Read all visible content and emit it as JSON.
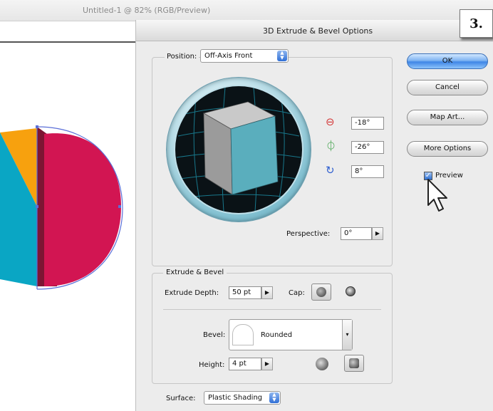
{
  "document": {
    "title": "Untitled-1 @ 82% (RGB/Preview)"
  },
  "step_badge": "3.",
  "dialog": {
    "title": "3D Extrude & Bevel Options",
    "position": {
      "label": "Position:",
      "value": "Off-Axis Front",
      "x_rotation": "-18°",
      "y_rotation": "-26°",
      "z_rotation": "8°",
      "perspective_label": "Perspective:",
      "perspective_value": "0°"
    },
    "extrude_bevel": {
      "legend": "Extrude & Bevel",
      "depth_label": "Extrude Depth:",
      "depth_value": "50 pt",
      "cap_label": "Cap:",
      "bevel_label": "Bevel:",
      "bevel_value": "Rounded",
      "height_label": "Height:",
      "height_value": "4 pt"
    },
    "surface": {
      "label": "Surface:",
      "value": "Plastic Shading"
    },
    "buttons": {
      "ok": "OK",
      "cancel": "Cancel",
      "map_art": "Map Art...",
      "more_options": "More Options"
    },
    "preview": {
      "label": "Preview",
      "checked": true
    }
  },
  "colors": {
    "pie_pink": "#d21552",
    "pie_dark": "#7d1533",
    "pie_blue": "#0aa6c4",
    "pie_orange": "#f7a10e",
    "cube_front": "#5aaebd",
    "cube_side": "#9a9a9a",
    "cube_top": "#c8c8c8"
  }
}
